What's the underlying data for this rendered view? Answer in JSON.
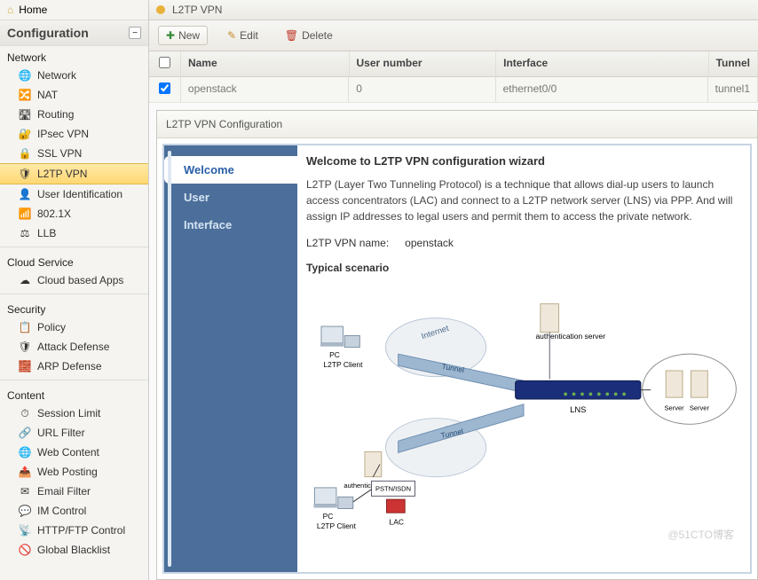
{
  "sidebar": {
    "home": "Home",
    "config": "Configuration",
    "sections": {
      "network": {
        "title": "Network",
        "items": [
          {
            "label": "Network",
            "icon": "🌐"
          },
          {
            "label": "NAT",
            "icon": "🔀"
          },
          {
            "label": "Routing",
            "icon": "🛣"
          },
          {
            "label": "IPsec VPN",
            "icon": "🔐"
          },
          {
            "label": "SSL VPN",
            "icon": "🔒"
          },
          {
            "label": "L2TP VPN",
            "icon": "🛡"
          },
          {
            "label": "User Identification",
            "icon": "👤"
          },
          {
            "label": "802.1X",
            "icon": "📶"
          },
          {
            "label": "LLB",
            "icon": "⚖"
          }
        ]
      },
      "cloud": {
        "title": "Cloud Service",
        "items": [
          {
            "label": "Cloud based Apps",
            "icon": "☁"
          }
        ]
      },
      "security": {
        "title": "Security",
        "items": [
          {
            "label": "Policy",
            "icon": "📋"
          },
          {
            "label": "Attack Defense",
            "icon": "🛡"
          },
          {
            "label": "ARP Defense",
            "icon": "🧱"
          }
        ]
      },
      "content": {
        "title": "Content",
        "items": [
          {
            "label": "Session Limit",
            "icon": "⏱"
          },
          {
            "label": "URL Filter",
            "icon": "🔗"
          },
          {
            "label": "Web Content",
            "icon": "🌐"
          },
          {
            "label": "Web Posting",
            "icon": "📤"
          },
          {
            "label": "Email Filter",
            "icon": "✉"
          },
          {
            "label": "IM Control",
            "icon": "💬"
          },
          {
            "label": "HTTP/FTP Control",
            "icon": "📡"
          },
          {
            "label": "Global Blacklist",
            "icon": "🚫"
          }
        ]
      }
    }
  },
  "tab": {
    "title": "L2TP VPN"
  },
  "toolbar": {
    "new": "New",
    "edit": "Edit",
    "delete": "Delete"
  },
  "grid": {
    "headers": {
      "name": "Name",
      "user": "User number",
      "iface": "Interface",
      "tunnel": "Tunnel"
    },
    "row": {
      "name": "openstack",
      "user": "0",
      "iface": "ethernet0/0",
      "tunnel": "tunnel1"
    }
  },
  "panel": {
    "title": "L2TP VPN Configuration"
  },
  "wizard": {
    "tabs": {
      "welcome": "Welcome",
      "user": "User",
      "interface": "Interface"
    },
    "heading": "Welcome to L2TP VPN configuration wizard",
    "desc": "L2TP (Layer Two Tunneling Protocol) is a technique that allows dial-up users to launch access concentrators (LAC) and connect to a L2TP network server (LNS) via PPP. And will assign IP addresses to legal users and permit them to access the private network.",
    "name_label": "L2TP VPN name:",
    "name_value": "openstack",
    "scenario": "Typical scenario",
    "diagram": {
      "pc1": "PC",
      "client1": "L2TP Client",
      "pc2": "PC",
      "client2": "L2TP Client",
      "internet": "Internet",
      "tunnel": "Tunnel",
      "auth1": "authentication server",
      "auth2": "authentication server",
      "pstn": "PSTN/ISDN",
      "lac": "LAC",
      "lns": "LNS",
      "server": "Server"
    }
  },
  "watermark": "@51CTO博客"
}
